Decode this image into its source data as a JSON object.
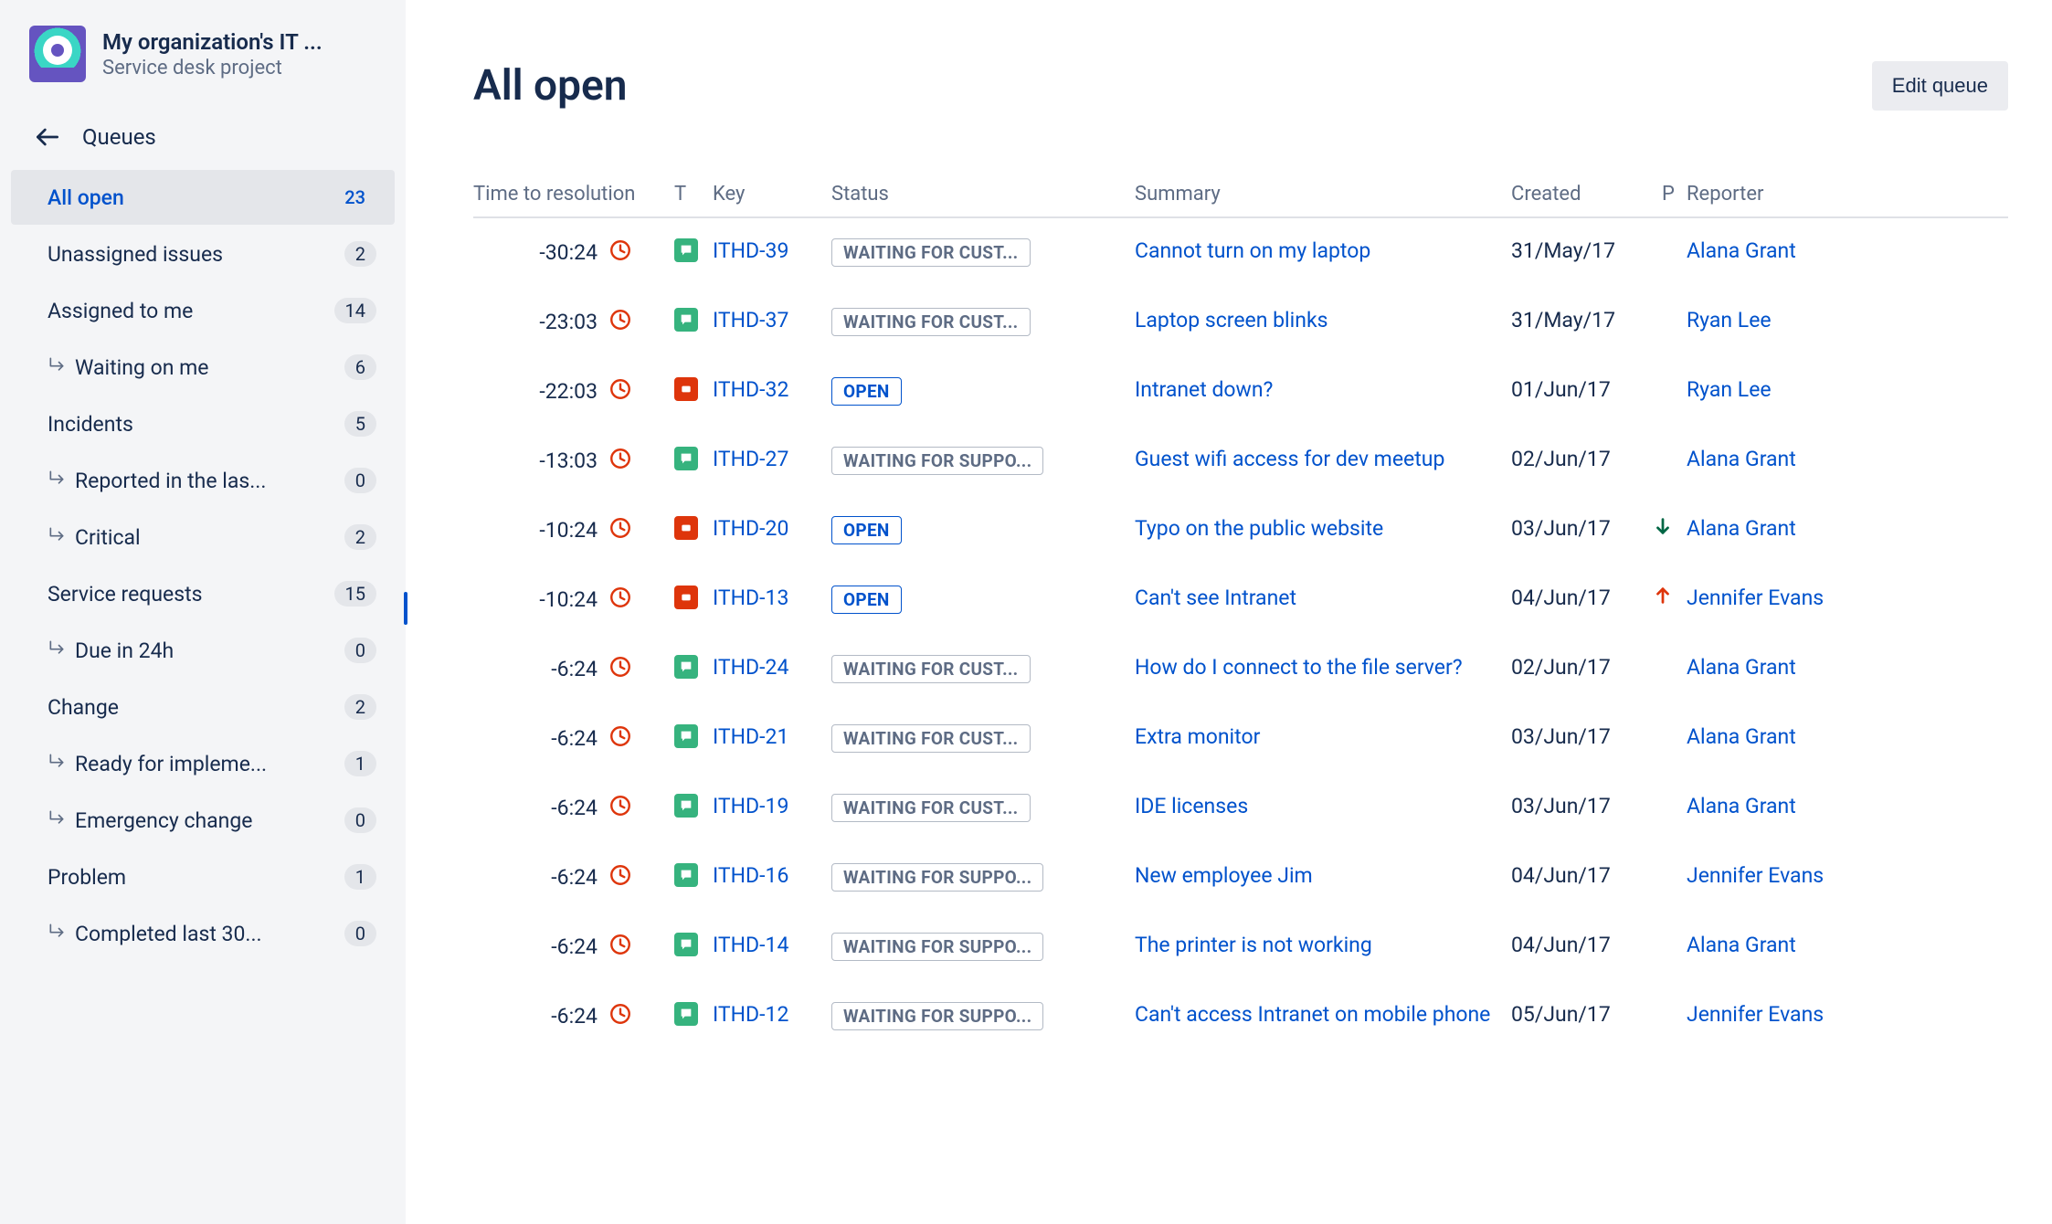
{
  "project": {
    "title": "My organization's IT ...",
    "subtitle": "Service desk project"
  },
  "nav": {
    "back_label": "Queues"
  },
  "queues": [
    {
      "label": "All open",
      "count": "23",
      "sub": false,
      "active": true
    },
    {
      "label": "Unassigned issues",
      "count": "2",
      "sub": false,
      "active": false
    },
    {
      "label": "Assigned to me",
      "count": "14",
      "sub": false,
      "active": false
    },
    {
      "label": "Waiting on me",
      "count": "6",
      "sub": true,
      "active": false
    },
    {
      "label": "Incidents",
      "count": "5",
      "sub": false,
      "active": false
    },
    {
      "label": "Reported in the las...",
      "count": "0",
      "sub": true,
      "active": false
    },
    {
      "label": "Critical",
      "count": "2",
      "sub": true,
      "active": false
    },
    {
      "label": "Service requests",
      "count": "15",
      "sub": false,
      "active": false
    },
    {
      "label": "Due in 24h",
      "count": "0",
      "sub": true,
      "active": false
    },
    {
      "label": "Change",
      "count": "2",
      "sub": false,
      "active": false
    },
    {
      "label": "Ready for impleme...",
      "count": "1",
      "sub": true,
      "active": false
    },
    {
      "label": "Emergency change",
      "count": "0",
      "sub": true,
      "active": false
    },
    {
      "label": "Problem",
      "count": "1",
      "sub": false,
      "active": false
    },
    {
      "label": "Completed last 30...",
      "count": "0",
      "sub": true,
      "active": false
    }
  ],
  "page": {
    "title": "All open",
    "edit_button": "Edit queue"
  },
  "columns": {
    "time": "Time to resolution",
    "type": "T",
    "key": "Key",
    "status": "Status",
    "summary": "Summary",
    "created": "Created",
    "priority": "P",
    "reporter": "Reporter"
  },
  "issues": [
    {
      "time": "-30:24",
      "type": "green",
      "key": "ITHD-39",
      "status": "WAITING FOR CUST...",
      "status_kind": "waiting",
      "summary": "Cannot turn on my laptop",
      "created": "31/May/17",
      "priority": "",
      "reporter": "Alana Grant"
    },
    {
      "time": "-23:03",
      "type": "green",
      "key": "ITHD-37",
      "status": "WAITING FOR CUST...",
      "status_kind": "waiting",
      "summary": "Laptop screen blinks",
      "created": "31/May/17",
      "priority": "",
      "reporter": "Ryan Lee"
    },
    {
      "time": "-22:03",
      "type": "red",
      "key": "ITHD-32",
      "status": "OPEN",
      "status_kind": "open",
      "summary": "Intranet down?",
      "created": "01/Jun/17",
      "priority": "",
      "reporter": "Ryan Lee"
    },
    {
      "time": "-13:03",
      "type": "green",
      "key": "ITHD-27",
      "status": "WAITING FOR SUPPO...",
      "status_kind": "waiting",
      "summary": "Guest wifi access for dev meetup",
      "created": "02/Jun/17",
      "priority": "",
      "reporter": "Alana Grant"
    },
    {
      "time": "-10:24",
      "type": "red",
      "key": "ITHD-20",
      "status": "OPEN",
      "status_kind": "open",
      "summary": "Typo on the public website",
      "created": "03/Jun/17",
      "priority": "down",
      "reporter": "Alana Grant"
    },
    {
      "time": "-10:24",
      "type": "red",
      "key": "ITHD-13",
      "status": "OPEN",
      "status_kind": "open",
      "summary": "Can't see Intranet",
      "created": "04/Jun/17",
      "priority": "up",
      "reporter": "Jennifer Evans"
    },
    {
      "time": "-6:24",
      "type": "green",
      "key": "ITHD-24",
      "status": "WAITING FOR CUST...",
      "status_kind": "waiting",
      "summary": "How do I connect to the file server?",
      "created": "02/Jun/17",
      "priority": "",
      "reporter": "Alana Grant"
    },
    {
      "time": "-6:24",
      "type": "green",
      "key": "ITHD-21",
      "status": "WAITING FOR CUST...",
      "status_kind": "waiting",
      "summary": "Extra monitor",
      "created": "03/Jun/17",
      "priority": "",
      "reporter": "Alana Grant"
    },
    {
      "time": "-6:24",
      "type": "green",
      "key": "ITHD-19",
      "status": "WAITING FOR CUST...",
      "status_kind": "waiting",
      "summary": "IDE licenses",
      "created": "03/Jun/17",
      "priority": "",
      "reporter": "Alana Grant"
    },
    {
      "time": "-6:24",
      "type": "green",
      "key": "ITHD-16",
      "status": "WAITING FOR SUPPO...",
      "status_kind": "waiting",
      "summary": "New employee Jim",
      "created": "04/Jun/17",
      "priority": "",
      "reporter": "Jennifer Evans"
    },
    {
      "time": "-6:24",
      "type": "green",
      "key": "ITHD-14",
      "status": "WAITING FOR SUPPO...",
      "status_kind": "waiting",
      "summary": "The printer is not working",
      "created": "04/Jun/17",
      "priority": "",
      "reporter": "Alana Grant"
    },
    {
      "time": "-6:24",
      "type": "green",
      "key": "ITHD-12",
      "status": "WAITING FOR SUPPO...",
      "status_kind": "waiting",
      "summary": "Can't access Intranet on mobile phone",
      "created": "05/Jun/17",
      "priority": "",
      "reporter": "Jennifer Evans"
    }
  ]
}
